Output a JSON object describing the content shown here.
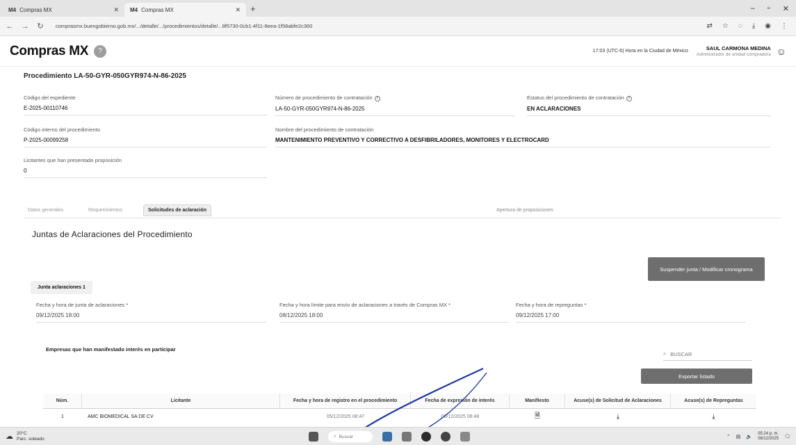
{
  "browser": {
    "tabs": [
      {
        "favicon": "M4",
        "label": "Compras MX"
      },
      {
        "favicon": "M4",
        "label": "Compras MX"
      }
    ],
    "url": "comprasmx.buengobierno.gob.mx/.../detalle/.../procedimientos/detalle/...8f5730-0cb1-4f11-8eea-1f58abfe2c360"
  },
  "header": {
    "logo": "Compras MX",
    "help_badge": "?",
    "timezone": "17:03 (UTC-6) Hora en la Ciudad de México",
    "user_name": "SAUL CARMONA MEDINA",
    "user_role": "Administrador de unidad compradora"
  },
  "procedure": {
    "title": "Procedimiento LA-50-GYR-050GYR974-N-86-2025",
    "fields": {
      "expediente": {
        "label": "Código del expediente",
        "value": "E-2025-00110746"
      },
      "numero": {
        "label": "Número de procedimiento de contratación",
        "value": "LA-50-GYR-050GYR974-N-86-2025"
      },
      "estatus": {
        "label": "Estatus del procedimiento de contratación",
        "value": "EN ACLARACIONES"
      },
      "interno": {
        "label": "Código interno del procedimiento",
        "value": "P-2025-00099258"
      },
      "nombre": {
        "label": "Nombre del procedimiento de contratación",
        "value": "MANTENIMIENTO PREVENTIVO Y CORRECTIVO A DESFIBRILADORES, MONITORES Y ELECTROCARD"
      },
      "licitantes": {
        "label": "Licitantes que han presentado proposición",
        "value": "0"
      }
    }
  },
  "tabs": {
    "generales": "Datos generales",
    "requerimientos": "Requerimientos",
    "aclaracion": "Solicitudes de aclaración",
    "far": "Apertura de proposiciones"
  },
  "juntas": {
    "section_title": "Juntas de Aclaraciones del Procedimiento",
    "suspend_button": "Suspender junta / Modificar cronograma",
    "subtab": "Junta aclaraciones 1",
    "fecha_junta": {
      "label": "Fecha y hora de junta de aclaraciones *",
      "value": "09/12/2025 18:00"
    },
    "fecha_limite": {
      "label": "Fecha y hora límite para envío de aclaraciones a través de Compras MX *",
      "value": "08/12/2025 18:00"
    },
    "fecha_repreguntas": {
      "label": "Fecha y hora de repreguntas *",
      "value": "09/12/2025 17:00"
    },
    "companies_label": "Empresas que han manifestado interés en participar",
    "search_placeholder": "BUSCAR",
    "export_button": "Exportar listado"
  },
  "table": {
    "headers": {
      "num": "Núm.",
      "licitante": "Licitante",
      "fecha_registro": "Fecha y hora de registro en el procedimiento",
      "fecha_interes": "Fecha de expresión de interés",
      "manifiesto": "Manifiesto",
      "acuse_sol": "Acuse(s) de Solicitud de Aclaraciones",
      "acuse_rep": "Acuse(s) de Repreguntas"
    },
    "rows": [
      {
        "num": "1",
        "licitante": "AMC BIOMEDICAL SA DE CV",
        "fecha_registro": "05/12/2025 08:47",
        "fecha_interes": "06/12/2025 06:48"
      }
    ]
  },
  "taskbar": {
    "weather_temp": "20°C",
    "weather_desc": "Parc. soleado",
    "search": "Buscar",
    "time": "05:24 p. m.",
    "date": "08/12/2025"
  },
  "colors": {
    "button_dark": "#6e6e6e",
    "pen_blue": "#1f3a9a"
  }
}
